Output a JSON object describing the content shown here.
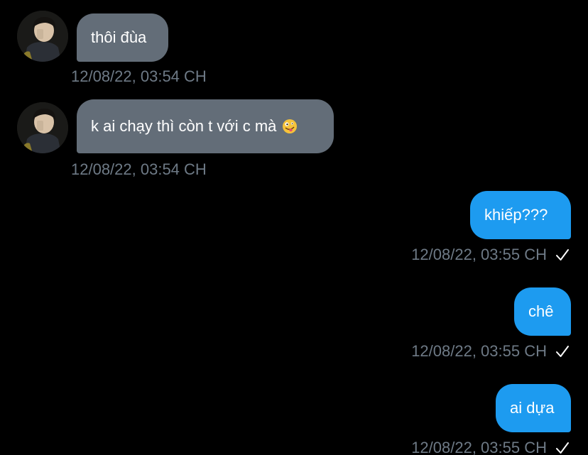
{
  "messages": [
    {
      "direction": "incoming",
      "text": "thôi đùa",
      "timestamp": "12/08/22, 03:54 CH"
    },
    {
      "direction": "incoming",
      "text": "k ai chạy thì còn t với c mà",
      "emoji": "zany-face",
      "timestamp": "12/08/22, 03:54 CH"
    },
    {
      "direction": "outgoing",
      "text": "khiếp???",
      "timestamp": "12/08/22, 03:55 CH",
      "status_icon": "checkmark-icon"
    },
    {
      "direction": "outgoing",
      "text": "chê",
      "timestamp": "12/08/22, 03:55 CH",
      "status_icon": "checkmark-icon"
    },
    {
      "direction": "outgoing",
      "text": "ai dựa",
      "timestamp": "12/08/22, 03:55 CH",
      "status_icon": "checkmark-icon"
    }
  ],
  "colors": {
    "background": "#000000",
    "incoming_bubble": "#636d78",
    "outgoing_bubble": "#1d9bf0",
    "timestamp_text": "#6e7a86",
    "bubble_text": "#ffffff"
  }
}
